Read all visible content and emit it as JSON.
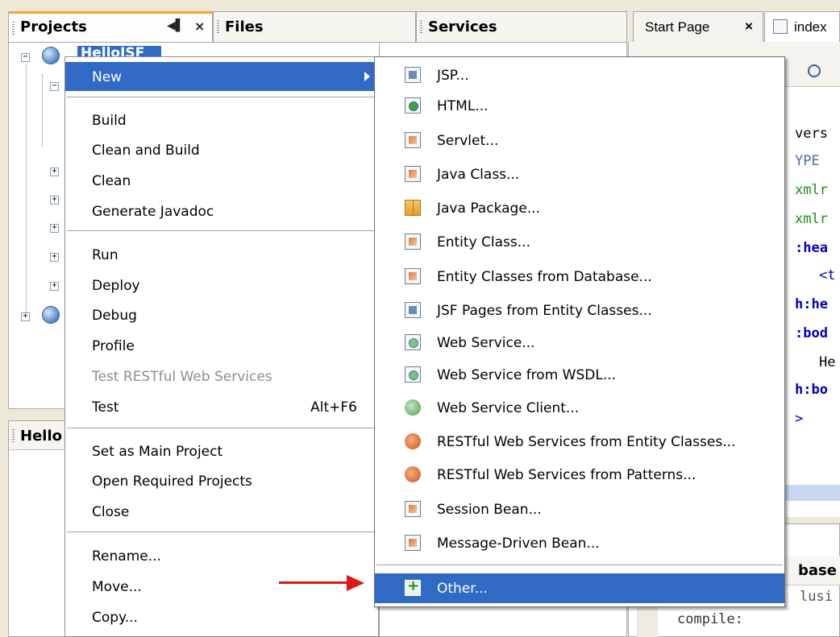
{
  "tabs": {
    "projects": "Projects",
    "files": "Files",
    "services": "Services",
    "start_page": "Start Page",
    "index": "index",
    "close": "×",
    "minimize": "◀▌"
  },
  "project_tree": {
    "root": "HelloJSF",
    "hello_panel": "Hello"
  },
  "context_menu": {
    "items": [
      {
        "label": "New"
      },
      {
        "label": "Build"
      },
      {
        "label": "Clean and Build"
      },
      {
        "label": "Clean"
      },
      {
        "label": "Generate Javadoc"
      },
      {
        "label": "Run"
      },
      {
        "label": "Deploy"
      },
      {
        "label": "Debug"
      },
      {
        "label": "Profile"
      },
      {
        "label": "Test RESTful Web Services"
      },
      {
        "label": "Test",
        "shortcut": "Alt+F6"
      },
      {
        "label": "Set as Main Project"
      },
      {
        "label": "Open Required Projects"
      },
      {
        "label": "Close"
      },
      {
        "label": "Rename..."
      },
      {
        "label": "Move..."
      },
      {
        "label": "Copy..."
      }
    ]
  },
  "new_submenu": {
    "items": [
      {
        "label": "JSP...",
        "icon": "jsp-icon"
      },
      {
        "label": "HTML...",
        "icon": "html-icon"
      },
      {
        "label": "Servlet...",
        "icon": "servlet-icon"
      },
      {
        "label": "Java Class...",
        "icon": "java-class-icon"
      },
      {
        "label": "Java Package...",
        "icon": "java-package-icon"
      },
      {
        "label": "Entity Class...",
        "icon": "entity-class-icon"
      },
      {
        "label": "Entity Classes from Database...",
        "icon": "entity-classes-db-icon"
      },
      {
        "label": "JSF Pages from Entity Classes...",
        "icon": "jsf-pages-icon"
      },
      {
        "label": "Web Service...",
        "icon": "web-service-icon"
      },
      {
        "label": "Web Service from WSDL...",
        "icon": "web-service-wsdl-icon"
      },
      {
        "label": "Web Service Client...",
        "icon": "web-service-client-icon"
      },
      {
        "label": "RESTful Web Services from Entity Classes...",
        "icon": "restful-entity-icon"
      },
      {
        "label": "RESTful Web Services from Patterns...",
        "icon": "restful-patterns-icon"
      },
      {
        "label": "Session Bean...",
        "icon": "session-bean-icon"
      },
      {
        "label": "Message-Driven Bean...",
        "icon": "message-bean-icon"
      },
      {
        "label": "Other...",
        "icon": "other-new-icon"
      }
    ]
  },
  "editor": {
    "lines": [
      "vers",
      "YPE",
      "xmlr",
      "xmlr",
      ":hea",
      "<t",
      "h:he",
      ":bod",
      "He",
      "h:bo",
      ">"
    ]
  },
  "output": {
    "panel": "base",
    "line1": "lusi",
    "line2": "compile:"
  },
  "colors": {
    "highlight": "#316ac5",
    "arrow": "#e01515",
    "tab_accent": "#f1a734"
  }
}
